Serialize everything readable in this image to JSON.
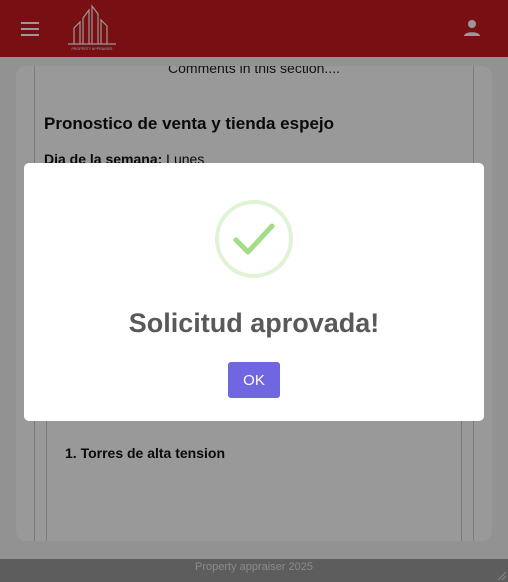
{
  "topbar": {
    "menu_icon": "menu-icon",
    "logo_text": "PROPERTY APPRAISER",
    "account_icon": "person-icon",
    "background": "#c8191e"
  },
  "content": {
    "comments_note": "Comments in this section....",
    "section_title": "Pronostico de venta y tienda espejo",
    "weekday_label": "Dia de la semana:",
    "weekday_value": "Lunes",
    "list_item_1": "1. Torres de alta tension"
  },
  "footer": {
    "text": "Property appraiser 2025"
  },
  "dialog": {
    "icon": "success-check-icon",
    "title": "Solicitud aprovada!",
    "ok_label": "OK",
    "accent": "#7066e0",
    "success_color": "#a5dc86"
  }
}
